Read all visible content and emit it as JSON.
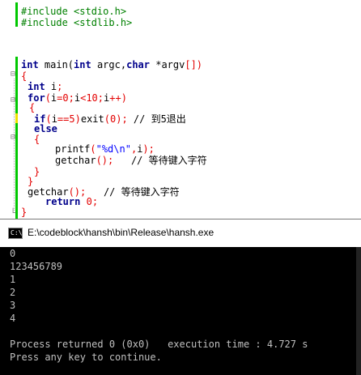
{
  "editor": {
    "lines": {
      "l1": {
        "pp": "#include <stdio.h>"
      },
      "l2": {
        "pp": "#include <stdlib.h>"
      },
      "l5": {
        "kw1": "int",
        "t1": " main(",
        "kw2": "int",
        "t2": " argc,",
        "kw3": "char",
        "t3": " *argv",
        "op1": "[])"
      },
      "l6": {
        "op1": "{"
      },
      "l7": {
        "kw1": "int",
        "t1": " i",
        "op1": ";"
      },
      "l8": {
        "kw1": "for",
        "op1": "(",
        "t1": "i",
        "op2": "=",
        "n1": "0",
        "op3": ";",
        "t2": "i",
        "op4": "<",
        "n2": "10",
        "op5": ";",
        "t3": "i",
        "op6": "++)"
      },
      "l9": {
        "op1": "{"
      },
      "l10": {
        "kw1": "if",
        "op1": "(",
        "t1": "i",
        "op2": "==",
        "n1": "5",
        "op3": ")",
        "t2": "exit",
        "op4": "(",
        "n2": "0",
        "op5": ");",
        "cm": " // 到5退出"
      },
      "l11": {
        "kw1": "else"
      },
      "l12": {
        "op1": "{"
      },
      "l13": {
        "t1": "printf",
        "op1": "(",
        "s1": "\"%d\\n\"",
        "op2": ",",
        "t2": "i",
        "op3": ");"
      },
      "l14": {
        "t1": "getchar",
        "op1": "();",
        "cm": "   // 等待键入字符"
      },
      "l15": {
        "op1": "}"
      },
      "l16": {
        "op1": "}"
      },
      "l17": {
        "t1": "getchar",
        "op1": "();",
        "cm": "   // 等待键入字符"
      },
      "l18": {
        "kw1": "return",
        "n1": " 0",
        "op1": ";"
      },
      "l19": {
        "op1": "}"
      }
    }
  },
  "console": {
    "title": "E:\\codeblock\\hansh\\bin\\Release\\hansh.exe",
    "icon_text": "C:\\",
    "output": [
      "0",
      "123456789",
      "1",
      "2",
      "3",
      "4",
      "",
      "Process returned 0 (0x0)   execution time : 4.727 s",
      "Press any key to continue."
    ]
  }
}
